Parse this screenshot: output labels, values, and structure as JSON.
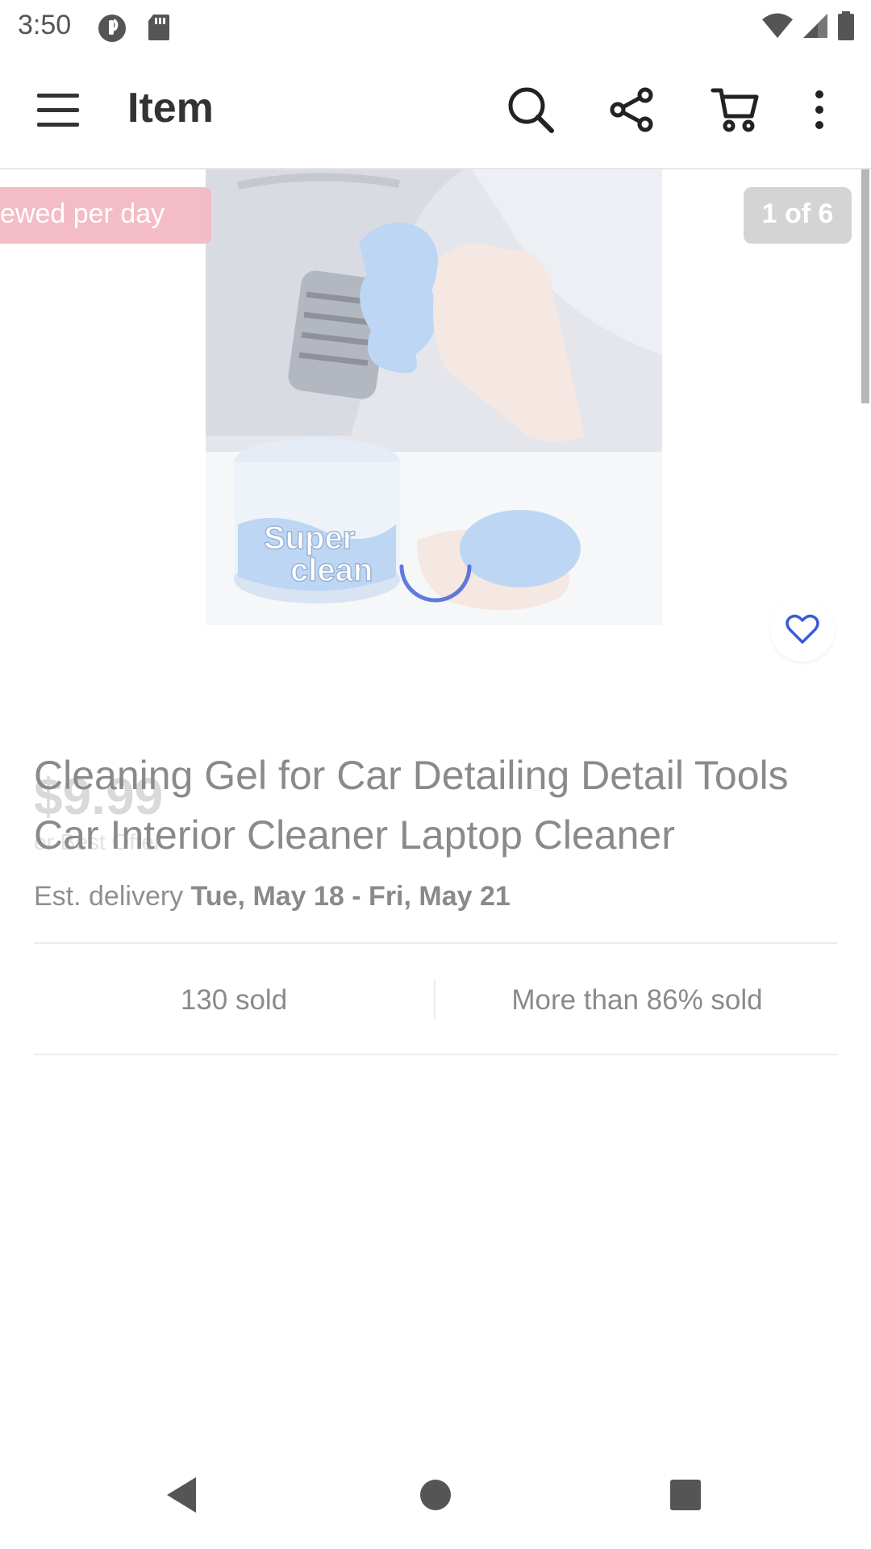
{
  "status_bar": {
    "time": "3:50"
  },
  "app_bar": {
    "title": "Item"
  },
  "gallery": {
    "views_badge": "ewed per day",
    "counter": "1 of 6",
    "image_text_1": "Super",
    "image_text_2": "clean"
  },
  "item": {
    "price": "$9.99",
    "best_offer": "or Best Offer",
    "title": "Cleaning Gel for Car Detailing Detail Tools Car Interior Cleaner Laptop Cleaner",
    "delivery_prefix": "Est. delivery ",
    "delivery_dates": "Tue, May 18 - Fri, May 21"
  },
  "stats": {
    "sold": "130 sold",
    "percent_sold": "More than 86% sold"
  },
  "colors": {
    "badge_pink": "#f4b9c3",
    "spinner_blue": "#3a5bd9",
    "favorite_outline": "#3a5bd9"
  }
}
